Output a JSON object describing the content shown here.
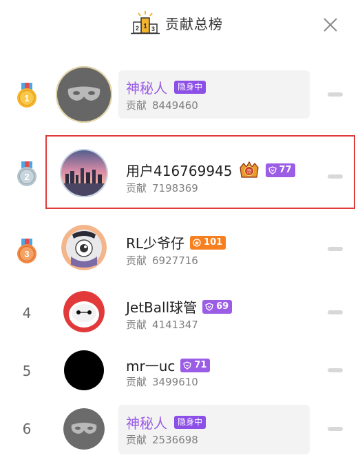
{
  "header": {
    "title": "贡献总榜"
  },
  "contribution_label": "贡献",
  "mystery_badge": "隐身中",
  "rows": [
    {
      "rank": "1",
      "name": "神秘人",
      "contribution": "8449460",
      "level": ""
    },
    {
      "rank": "2",
      "name": "用户416769945",
      "contribution": "7198369",
      "level": "77"
    },
    {
      "rank": "3",
      "name": "RL少爷仔",
      "contribution": "6927716",
      "level": "101"
    },
    {
      "rank": "4",
      "name": "JetBall球管",
      "contribution": "4141347",
      "level": "69"
    },
    {
      "rank": "5",
      "name": "mr一uc",
      "contribution": "3499610",
      "level": "71"
    },
    {
      "rank": "6",
      "name": "神秘人",
      "contribution": "2536698",
      "level": ""
    }
  ],
  "colors": {
    "mystery_name": "#9a5ce6",
    "level_purple": "#9b5de5",
    "level_orange": "#f6801f",
    "highlight_border": "#e03b3b"
  }
}
